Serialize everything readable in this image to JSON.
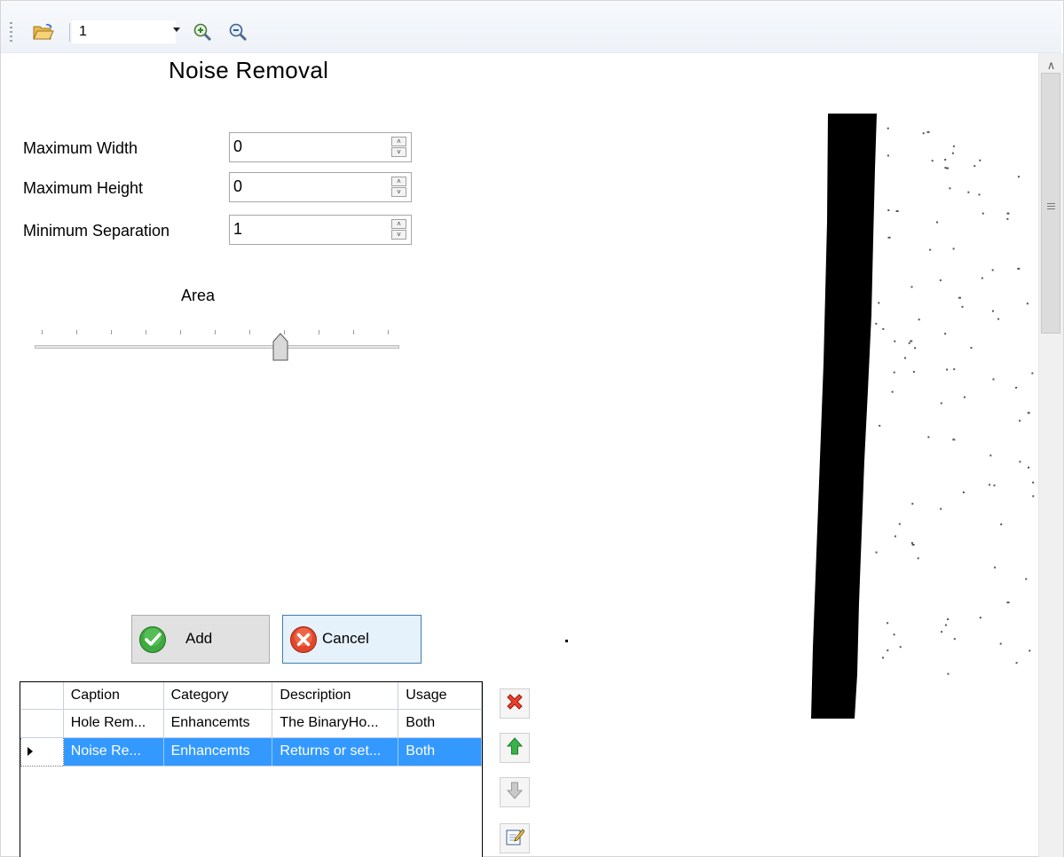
{
  "toolbar": {
    "open_icon": "open-folder-icon",
    "page_value": "1",
    "zoom_in_icon": "zoom-in-icon",
    "zoom_out_icon": "zoom-out-icon"
  },
  "form": {
    "title": "Noise Removal",
    "fields": [
      {
        "label": "Maximum Width",
        "value": "0"
      },
      {
        "label": "Maximum Height",
        "value": "0"
      },
      {
        "label": "Minimum Separation",
        "value": "1"
      }
    ],
    "area_label": "Area",
    "area_slider_value": 0.69
  },
  "buttons": {
    "add_label": "Add",
    "cancel_label": "Cancel"
  },
  "grid": {
    "columns": [
      "Caption",
      "Category",
      "Description",
      "Usage"
    ],
    "rows": [
      {
        "caption": "Hole Rem...",
        "category": "Enhancemts",
        "description": "The BinaryHo...",
        "usage": "Both",
        "selected": false
      },
      {
        "caption": "Noise Re...",
        "category": "Enhancemts",
        "description": "Returns or set...",
        "usage": "Both",
        "selected": true
      }
    ]
  },
  "side_actions": [
    "delete-icon",
    "move-up-icon",
    "move-down-icon",
    "edit-icon"
  ],
  "colors": {
    "selection": "#3399ff",
    "delete": "#e8412c",
    "up": "#3bb34a"
  }
}
